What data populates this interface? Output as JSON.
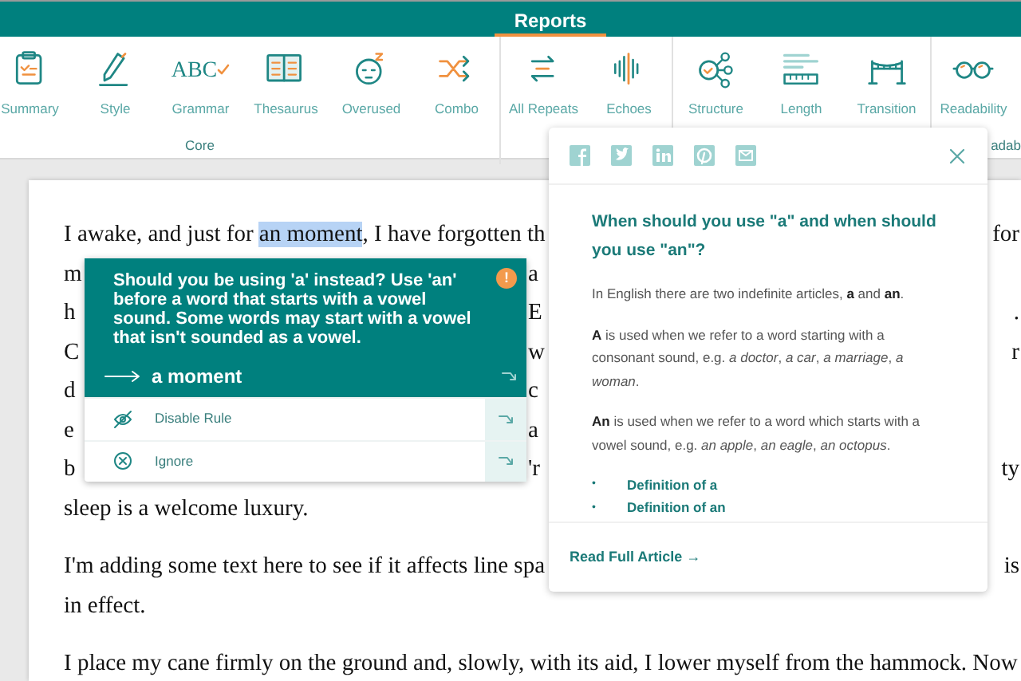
{
  "header": {
    "tab": "Reports",
    "selected": true
  },
  "toolbar": {
    "items": [
      {
        "label": "Summary"
      },
      {
        "label": "Style"
      },
      {
        "label": "Grammar",
        "glyph": "ABC"
      },
      {
        "label": "Thesaurus"
      },
      {
        "label": "Overused"
      },
      {
        "label": "Combo"
      },
      {
        "label": "All Repeats"
      },
      {
        "label": "Echoes"
      },
      {
        "label": "Structure"
      },
      {
        "label": "Length"
      },
      {
        "label": "Transition"
      },
      {
        "label": "Readability"
      }
    ],
    "groups": [
      "Core",
      "adab"
    ]
  },
  "document": {
    "paragraphs": [
      {
        "lines": [
          {
            "segments": [
              {
                "text": "I awake, and just for ",
                "highlighted": false
              },
              {
                "text": "an moment",
                "highlighted": true
              },
              {
                "text": ", I have forgotten th",
                "highlighted": false
              }
            ],
            "right": "for"
          },
          {
            "segments": [
              {
                "text": "m",
                "highlighted": false
              }
            ],
            "middle": "a"
          },
          {
            "segments": [
              {
                "text": "h",
                "highlighted": false
              }
            ],
            "middle": "E",
            "right": "."
          },
          {
            "segments": [
              {
                "text": "C",
                "highlighted": false
              }
            ],
            "middle": "w",
            "right": "r"
          },
          {
            "segments": [
              {
                "text": "d",
                "highlighted": false
              }
            ],
            "middle": "c"
          },
          {
            "segments": [
              {
                "text": "e",
                "highlighted": false
              }
            ],
            "middle": "a"
          },
          {
            "segments": [
              {
                "text": "b",
                "highlighted": false
              }
            ],
            "middle": "'r",
            "right": "ty"
          },
          {
            "segments": [
              {
                "text": "sleep is a welcome luxury.",
                "highlighted": false
              }
            ]
          }
        ]
      },
      {
        "lines": [
          {
            "segments": [
              {
                "text": "I'm adding some text here to see if it affects line spa",
                "highlighted": false
              }
            ],
            "right": "is"
          },
          {
            "segments": [
              {
                "text": "in effect.",
                "highlighted": false
              }
            ]
          }
        ]
      },
      {
        "lines": [
          {
            "segments": [
              {
                "text": "I place my cane firmly on the ground and, slowly, with its aid, I lower myself from the hammock. Now",
                "highlighted": false
              }
            ]
          }
        ]
      }
    ]
  },
  "suggestion_popup": {
    "message": "Should you be using 'a' instead? Use 'an' before a word that starts with a vowel sound. Some words may start with a vowel that isn't sounded as a vowel.",
    "info_badge": "!",
    "replacement": "a moment",
    "actions": [
      {
        "label": "Disable Rule"
      },
      {
        "label": "Ignore"
      }
    ]
  },
  "article_card": {
    "title": "When should you use \"a\" and when should you use \"an\"?",
    "paragraphs": [
      "In English there are two indefinite articles, **a** and **an**.",
      "**A** is used when we refer to a word starting with a consonant sound, e.g. *a doctor*, *a car*, *a marriage*, *a woman*.",
      "**An** is used when we refer to a word which starts with a vowel sound, e.g. *an apple*, *an eagle*, *an octopus*."
    ],
    "links": [
      "Definition of a",
      "Definition of an"
    ],
    "bullet": "•",
    "footer_link": "Read Full Article →"
  }
}
